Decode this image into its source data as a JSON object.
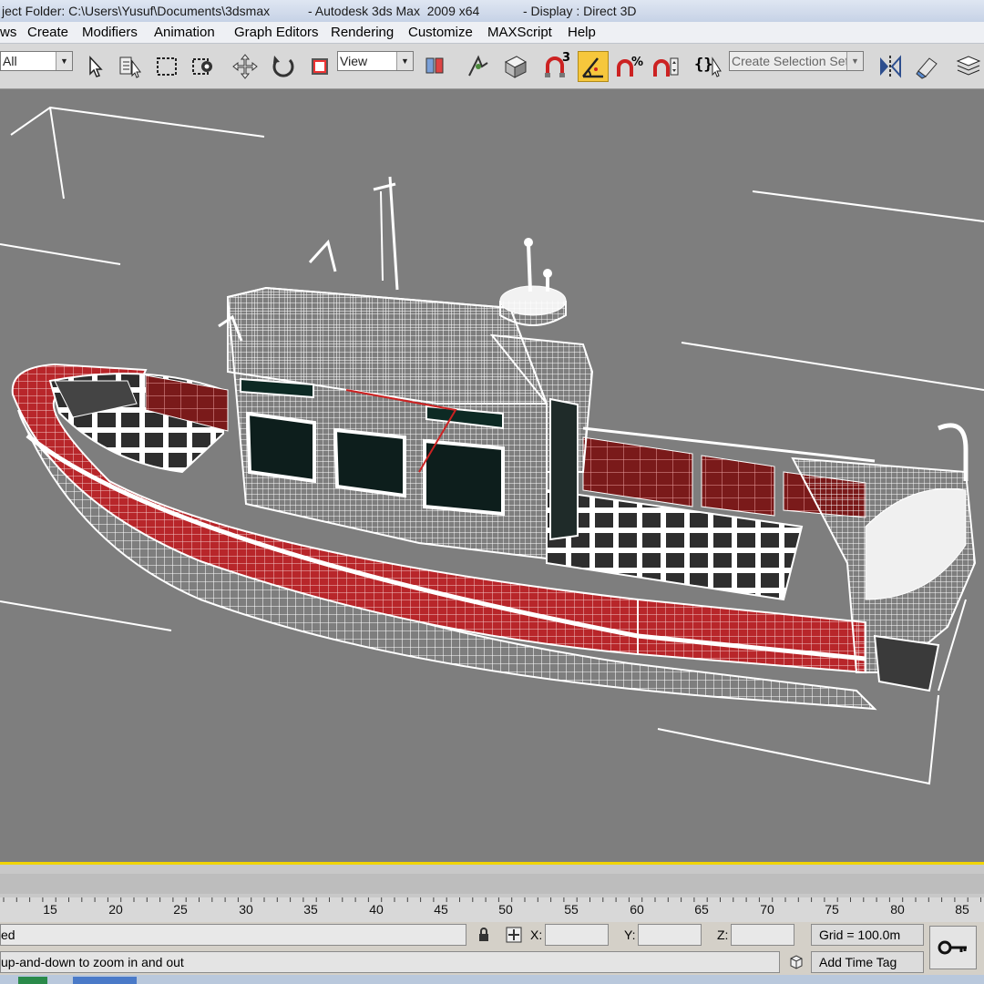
{
  "window": {
    "title_project": "ject Folder: C:\\Users\\Yusuf\\Documents\\3dsmax",
    "title_app": "- Autodesk 3ds Max  2009 x64",
    "title_display": "- Display : Direct 3D"
  },
  "menu": {
    "items": [
      "ws",
      "Create",
      "Modifiers",
      "Animation",
      "Graph Editors",
      "Rendering",
      "Customize",
      "MAXScript",
      "Help"
    ]
  },
  "toolbar": {
    "selection_filter": "All",
    "reference_coord": "View",
    "named_selection_placeholder": "Create Selection Set",
    "icons": [
      "select-object-icon",
      "select-by-name-icon",
      "rectangular-selection-icon",
      "window-crossing-icon",
      "move-icon",
      "rotate-icon",
      "scale-icon",
      "pivot-icon",
      "select-manipulate-icon",
      "keyboard-shortcut-icon",
      "snaps-3d-icon",
      "angle-snap-icon",
      "percent-snap-icon",
      "spinner-snap-icon",
      "edit-named-selection-icon",
      "mirror-icon",
      "align-icon",
      "layer-manager-icon"
    ],
    "snap_label": "3",
    "accent": "#f6c73c"
  },
  "viewport": {
    "background": "#7e7e7e",
    "active_border": "#f1d300",
    "model_colors": {
      "wire": "#ffffff",
      "tube": "#b8262a",
      "window": "#0d1e1c",
      "grid": "#ffffff"
    }
  },
  "timeline": {
    "ticks": [
      "15",
      "20",
      "25",
      "30",
      "35",
      "40",
      "45",
      "50",
      "55",
      "60",
      "65",
      "70",
      "75",
      "80",
      "85"
    ]
  },
  "status": {
    "selection_text": "ed",
    "prompt": "up-and-down to zoom in and out",
    "x_label": "X:",
    "y_label": "Y:",
    "z_label": "Z:",
    "x_value": "",
    "y_value": "",
    "z_value": "",
    "grid": "Grid = 100.0m",
    "add_time_tag": "Add Time Tag"
  }
}
